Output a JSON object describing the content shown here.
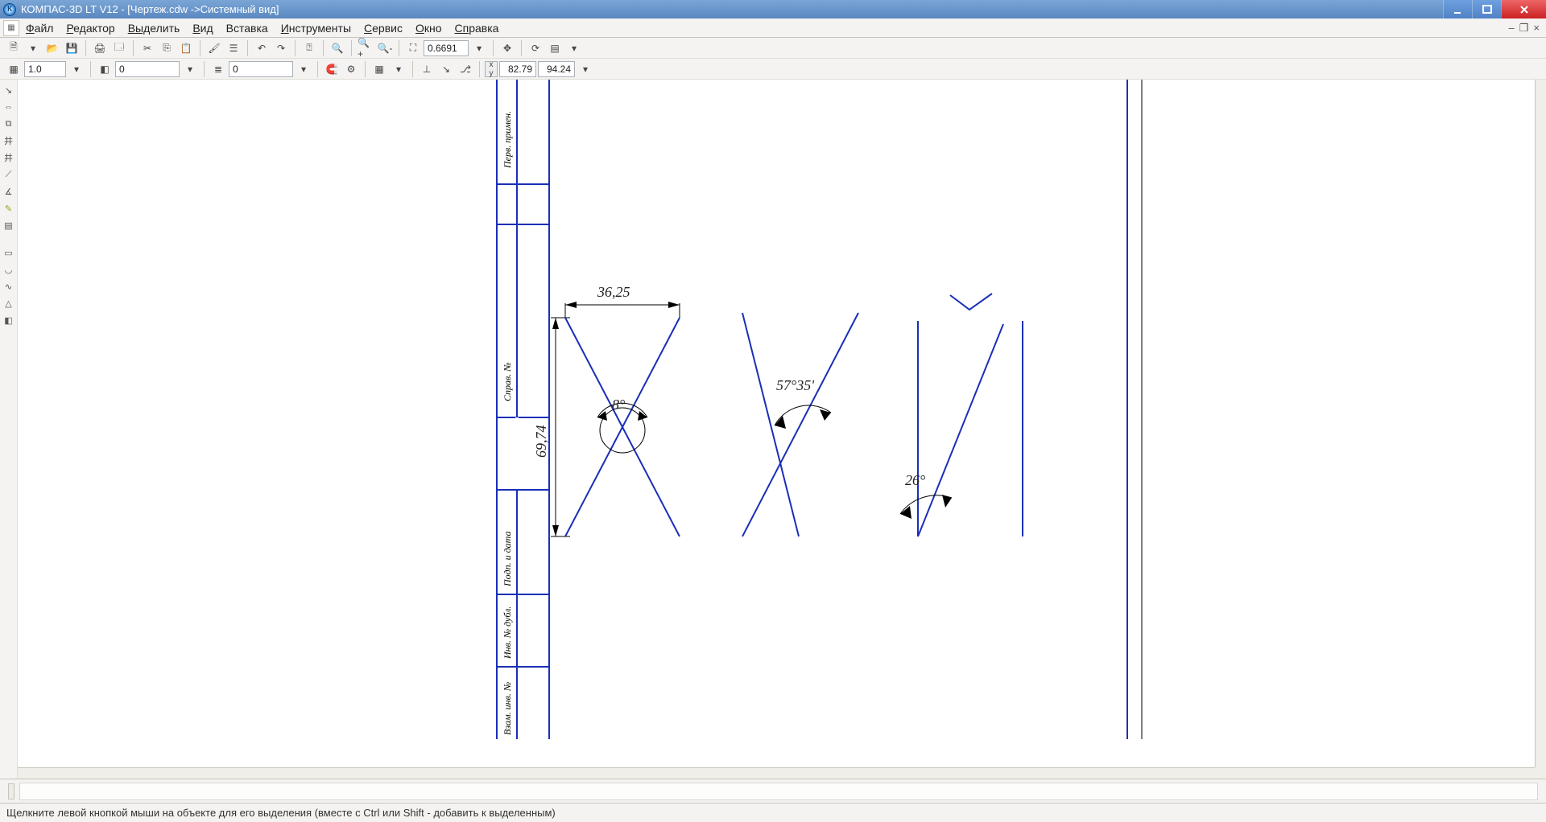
{
  "window": {
    "title": "КОМПАС-3D LT V12 - [Чертеж.cdw ->Системный вид]"
  },
  "menu": {
    "file": {
      "raw": "Файл",
      "u": "Ф",
      "rest": "айл"
    },
    "edit": {
      "raw": "Редактор",
      "u": "Р",
      "rest": "едактор"
    },
    "select": {
      "raw": "Выделить",
      "u": "Выд",
      "rest": "елить"
    },
    "view": {
      "raw": "Вид",
      "u": "В",
      "rest": "ид"
    },
    "insert": {
      "raw": "Вставка",
      "u": "",
      "rest": "Вставка"
    },
    "tools": {
      "raw": "Инструменты",
      "u": "И",
      "rest": "нструменты"
    },
    "service": {
      "raw": "Сервис",
      "u": "С",
      "rest": "ервис"
    },
    "window": {
      "raw": "Окно",
      "u": "О",
      "rest": "кно"
    },
    "help": {
      "raw": "Справка",
      "u": "Сп",
      "rest": "равка"
    }
  },
  "toolbar1": {
    "zoom": "0.6691"
  },
  "toolbar2": {
    "style": "1.0",
    "layer1": "0",
    "layer2": "0",
    "coord_x": "82.79",
    "coord_y": "94.24"
  },
  "drawing": {
    "dim_h": "36,25",
    "dim_v": "69,74",
    "angle1": "8°",
    "angle2": "57°35'",
    "angle3": "26°",
    "stamp": {
      "t1": "Перв. примен.",
      "t2": "Справ. №",
      "t3": "Подп. и дата",
      "t4": "Инв. № дубл.",
      "t5": "Взам. инв. №"
    }
  },
  "status": "Щелкните левой кнопкой мыши на объекте для его выделения (вместе с Ctrl или Shift - добавить к выделенным)"
}
